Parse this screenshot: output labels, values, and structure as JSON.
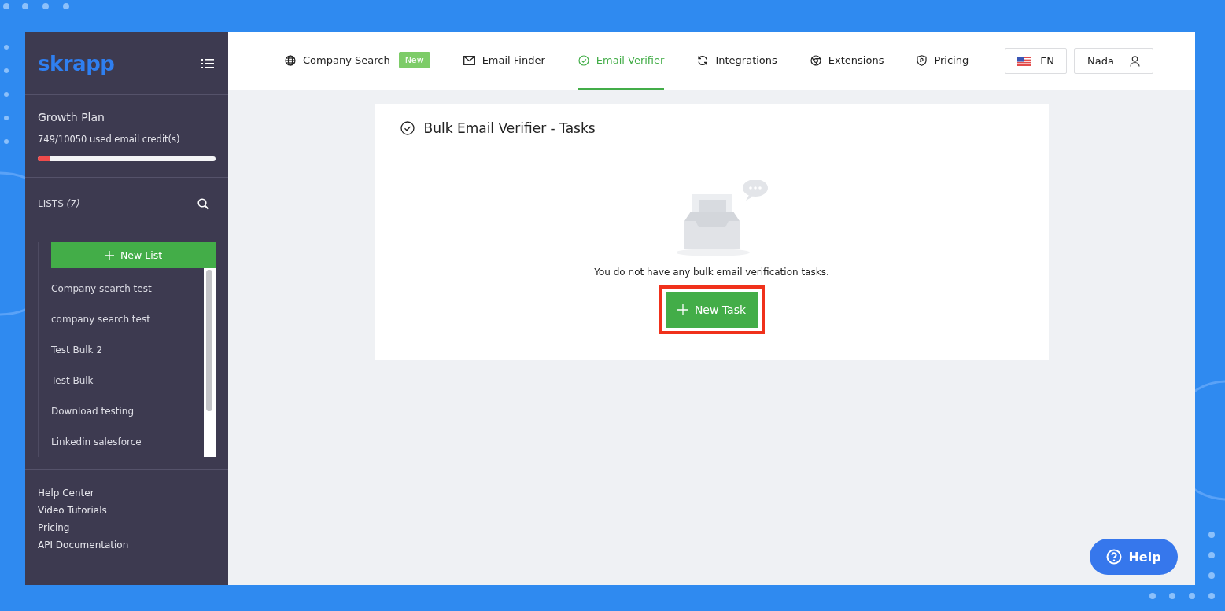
{
  "sidebar": {
    "logo": "skrapp",
    "plan": {
      "name": "Growth Plan",
      "usage": "749/10050 used email credit(s)",
      "level": 0.07
    },
    "lists": {
      "label": "LISTS",
      "count": "(7)",
      "new_button": "New List",
      "items": [
        "Company search test",
        "company search test",
        "Test Bulk 2",
        "Test Bulk",
        "Download testing",
        "Linkedin salesforce"
      ]
    },
    "links": [
      "Help Center",
      "Video Tutorials",
      "Pricing",
      "API Documentation"
    ]
  },
  "nav": [
    {
      "kind": "globe",
      "label": "Company Search",
      "badge": "New",
      "selected": false
    },
    {
      "kind": "mail",
      "label": "Email Finder",
      "selected": false
    },
    {
      "kind": "check",
      "label": "Email Verifier",
      "selected": true
    },
    {
      "kind": "sync",
      "label": "Integrations",
      "selected": false
    },
    {
      "kind": "chrome",
      "label": "Extensions",
      "selected": false
    },
    {
      "kind": "shield",
      "label": "Pricing",
      "selected": false
    }
  ],
  "language": "EN",
  "user": "Nada",
  "card": {
    "title": "Bulk Email Verifier - Tasks",
    "empty_message": "You do not have any bulk email verification tasks.",
    "button": "New Task",
    "button_highlighted": true
  },
  "help_button": "Help"
}
